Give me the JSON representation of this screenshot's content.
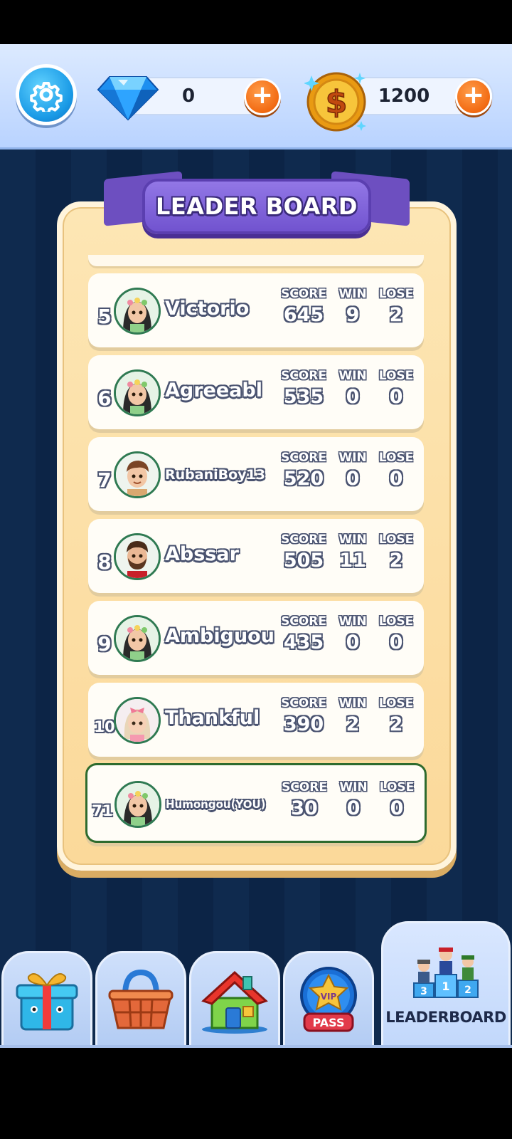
{
  "colors": {
    "background": "#0f2a4e",
    "topbar": "#c9dcff",
    "board": "#fbd99a",
    "ribbon": "#7a5bd6",
    "plus_button": "#f26a12",
    "player_row_highlight": "#2e6b2e"
  },
  "topbar": {
    "settings_icon": "gear-icon",
    "gems": {
      "icon": "diamond-icon",
      "value": "0",
      "add_icon": "plus-icon"
    },
    "coins": {
      "icon": "dollar-coin-icon",
      "value": "1200",
      "add_icon": "plus-icon"
    }
  },
  "leaderboard": {
    "title": "LEADER BOARD",
    "labels": {
      "score": "SCORE",
      "win": "WIN",
      "lose": "LOSE"
    },
    "rows": [
      {
        "rank": "5",
        "name": "Victorio",
        "avatar": "girl-flower-crown-avatar",
        "score": "645",
        "win": "9",
        "lose": "2"
      },
      {
        "rank": "6",
        "name": "Agreeabl",
        "avatar": "girl-flower-crown-avatar",
        "score": "535",
        "win": "0",
        "lose": "0"
      },
      {
        "rank": "7",
        "name": "RubaniBoy13",
        "avatar": "boy-brown-hair-avatar",
        "score": "520",
        "win": "0",
        "lose": "0"
      },
      {
        "rank": "8",
        "name": "Abssar",
        "avatar": "bearded-man-avatar",
        "score": "505",
        "win": "11",
        "lose": "2"
      },
      {
        "rank": "9",
        "name": "Ambiguou",
        "avatar": "girl-flower-crown-avatar",
        "score": "435",
        "win": "0",
        "lose": "0"
      },
      {
        "rank": "10",
        "name": "Thankful",
        "avatar": "blonde-girl-bow-avatar",
        "score": "390",
        "win": "2",
        "lose": "2"
      },
      {
        "rank": "71",
        "name": "Humongou(YOU)",
        "avatar": "girl-flower-crown-avatar",
        "score": "30",
        "win": "0",
        "lose": "0",
        "is_current_user": true
      }
    ]
  },
  "bottom_nav": {
    "tabs": [
      {
        "id": "gift",
        "icon": "gift-box-icon"
      },
      {
        "id": "shop",
        "icon": "shopping-basket-icon"
      },
      {
        "id": "home",
        "icon": "house-icon"
      },
      {
        "id": "vip",
        "icon": "vip-pass-icon",
        "badge_top": "VIP",
        "badge_bottom": "PASS"
      },
      {
        "id": "leaderboard",
        "icon": "podium-icon",
        "label": "LEADERBOARD",
        "active": true
      }
    ]
  }
}
